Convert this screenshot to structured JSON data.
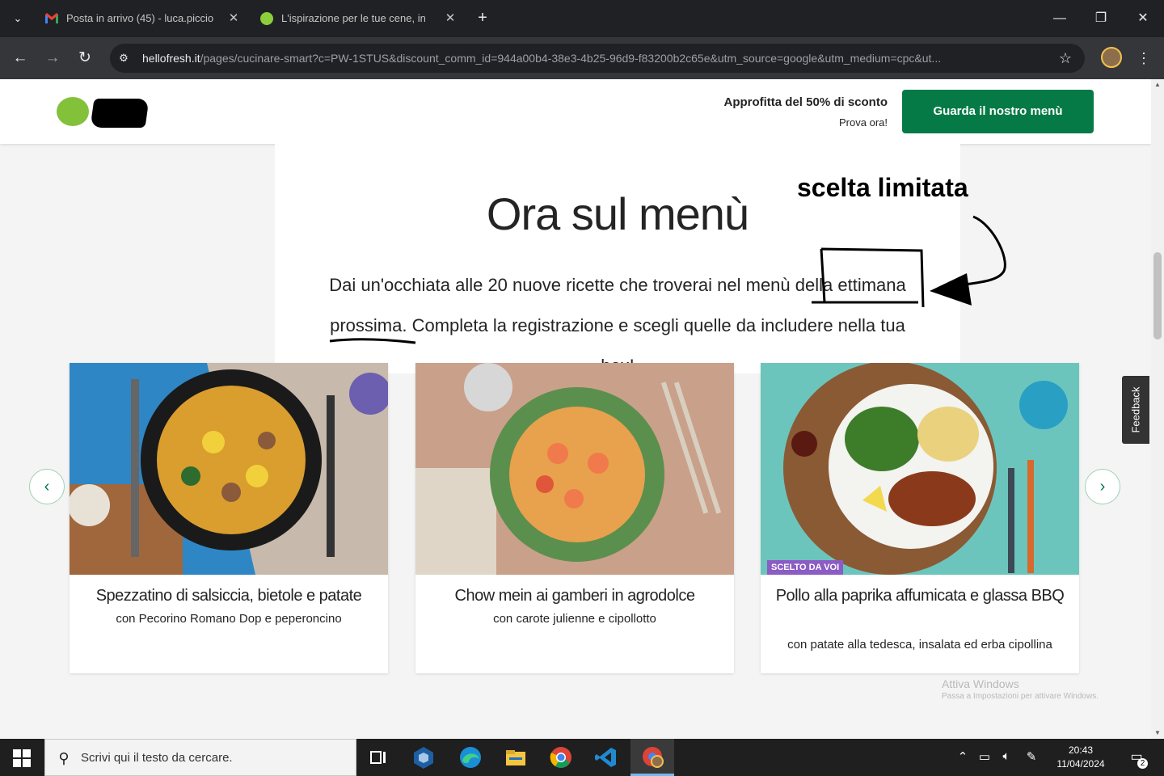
{
  "browser": {
    "tabs": [
      {
        "title": "Posta in arrivo (45) - luca.piccio",
        "favicon": "gmail-icon"
      },
      {
        "title": "L'ispirazione per le tue cene, in",
        "favicon": "hellofresh-lime-icon"
      }
    ],
    "close_glyph": "✕",
    "new_tab_glyph": "+",
    "window_controls": {
      "minimize": "—",
      "restore": "❐",
      "close": "✕"
    },
    "nav": {
      "back": "←",
      "forward": "→",
      "reload": "↻"
    },
    "url_host": "hellofresh.it",
    "url_rest": "/pages/cucinare-smart?c=PW-1STUS&discount_comm_id=944a00b4-38e3-4b25-96d9-f83200b2c65e&utm_source=google&utm_medium=cpc&ut...",
    "bookmark_glyph": "☆",
    "menu_glyph": "⋮"
  },
  "header": {
    "promo_title": "Approfitta del 50% di sconto",
    "promo_subtitle": "Prova ora!",
    "cta_label": "Guarda il nostro menù"
  },
  "hero": {
    "title": "Ora sul menù",
    "text_before": "Dai un'occhiata alle 20 nuove ricette che troverai nel menù della ",
    "text_highlight": "ettimana",
    "text_underlined": "prossima.",
    "text_after": " Completa la registrazione e scegli quelle da includere nella tua box!"
  },
  "annotation": {
    "label": "scelta limitata"
  },
  "carousel": {
    "prev_glyph": "‹",
    "next_glyph": "›",
    "cards": [
      {
        "title": "Spezzatino di salsiccia, bietole e patate",
        "subtitle": "con Pecorino Romano Dop e peperoncino"
      },
      {
        "title": "Chow mein ai gamberi in agrodolce",
        "subtitle": "con carote julienne e cipollotto"
      },
      {
        "title": "Pollo alla paprika affumicata e glassa BBQ",
        "subtitle": "con patate alla tedesca, insalata ed erba cipollina",
        "badge": "SCELTO DA VOI"
      }
    ]
  },
  "feedback_label": "Feedback",
  "watermark": {
    "line1": "Attiva Windows",
    "line2": "Passa a Impostazioni per attivare Windows."
  },
  "taskbar": {
    "search_placeholder": "Scrivi qui il testo da cercare.",
    "time": "20:43",
    "date": "11/04/2024",
    "notification_count": "2"
  },
  "colors": {
    "brand_green": "#067a46",
    "lime": "#84c13a",
    "badge_purple": "#8b5cc4"
  }
}
